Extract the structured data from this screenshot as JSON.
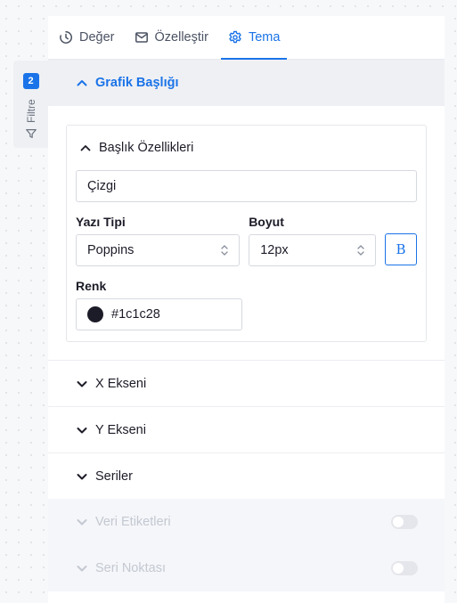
{
  "filter_tab": {
    "count": "2",
    "label": "Filtre"
  },
  "tabs": [
    {
      "label": "Değer",
      "icon": "clock-icon"
    },
    {
      "label": "Özelleştir",
      "icon": "mail-icon"
    },
    {
      "label": "Tema",
      "icon": "gear-icon",
      "active": true
    }
  ],
  "title_section": {
    "heading": "Grafik Başlığı",
    "properties": {
      "heading": "Başlık Özellikleri",
      "title_value": "Çizgi",
      "font_label": "Yazı Tipi",
      "font_value": "Poppins",
      "size_label": "Boyut",
      "size_value": "12px",
      "bold_label": "B",
      "color_label": "Renk",
      "color_value": "#1c1c28"
    }
  },
  "sections": {
    "x_axis": "X Ekseni",
    "y_axis": "Y Ekseni",
    "series": "Seriler",
    "data_labels": "Veri Etiketleri",
    "series_point": "Seri Noktası"
  },
  "colors": {
    "accent": "#1a73e8",
    "text": "#1c1c28",
    "disabled": "#c4c8d2"
  }
}
